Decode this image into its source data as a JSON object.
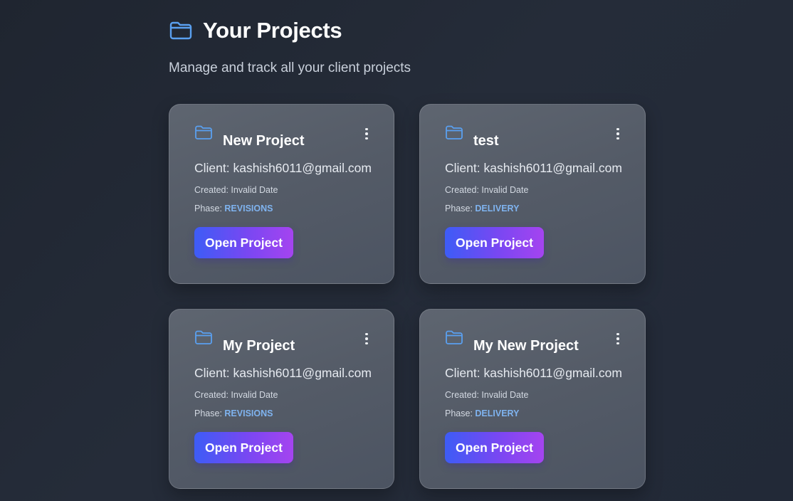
{
  "header": {
    "title": "Your Projects",
    "icon": "folder-icon",
    "accent_color": "#5aa0f0"
  },
  "subtitle": "Manage and track all your client projects",
  "projects": [
    {
      "title": "New Project",
      "client_label": "Client: kashish6011@gmail.com",
      "created_label": "Created: Invalid Date",
      "phase_prefix": "Phase: ",
      "phase": "REVISIONS",
      "button_label": "Open Project"
    },
    {
      "title": "test",
      "client_label": "Client: kashish6011@gmail.com",
      "created_label": "Created: Invalid Date",
      "phase_prefix": "Phase: ",
      "phase": "DELIVERY",
      "button_label": "Open Project"
    },
    {
      "title": "My Project",
      "client_label": "Client: kashish6011@gmail.com",
      "created_label": "Created: Invalid Date",
      "phase_prefix": "Phase: ",
      "phase": "REVISIONS",
      "button_label": "Open Project"
    },
    {
      "title": "My New Project",
      "client_label": "Client: kashish6011@gmail.com",
      "created_label": "Created: Invalid Date",
      "phase_prefix": "Phase: ",
      "phase": "DELIVERY",
      "button_label": "Open Project"
    }
  ],
  "colors": {
    "button_gradient_start": "#3d5cf6",
    "button_gradient_end": "#a544f0",
    "phase_color": "#7fb3ef"
  }
}
